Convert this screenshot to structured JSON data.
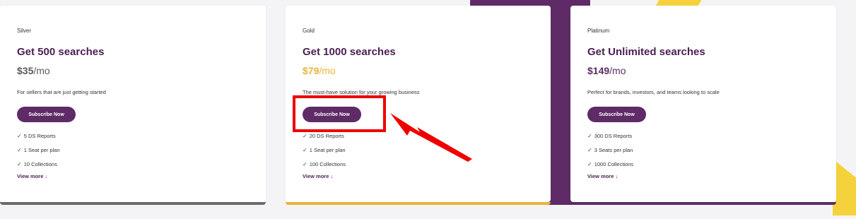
{
  "plans": [
    {
      "tier": "Silver",
      "headline": "Get 500 searches",
      "price": "$35",
      "per": "/mo",
      "price_color": "#5a5a5a",
      "description": "For sellers that are just getting started",
      "cta": "Subscribe Now",
      "features": [
        "5 DS Reports",
        "1 Seat per plan",
        "10 Collections"
      ],
      "view_more": "View more ↓",
      "bar_color": "#6b6b6b"
    },
    {
      "tier": "Gold",
      "headline": "Get 1000 searches",
      "price": "$79",
      "per": "/mo",
      "price_color": "#e9b53a",
      "description": "The must-have solution for your growing business",
      "cta": "Subscribe Now",
      "features": [
        "20 DS Reports",
        "1 Seat per plan",
        "100 Collections"
      ],
      "view_more": "View more ↓",
      "bar_color": "#e9b53a"
    },
    {
      "tier": "Platinum",
      "headline": "Get Unlimited searches",
      "price": "$149",
      "per": "/mo",
      "price_color": "#5e2b66",
      "description": "Perfect for brands, investors, and teams looking to scale",
      "cta": "Subscribe Now",
      "features": [
        "300 DS Reports",
        "3 Seats per plan",
        "1000 Collections"
      ],
      "view_more": "View more ↓",
      "bar_color": "#5e2b66"
    }
  ],
  "colors": {
    "brand_purple": "#5e2b66",
    "headline": "#4a1f52",
    "annotation_red": "#ee0000",
    "accent_yellow": "#f5d23c"
  },
  "icons": {
    "feature": "check-icon",
    "annotation": "red-arrow-icon"
  }
}
